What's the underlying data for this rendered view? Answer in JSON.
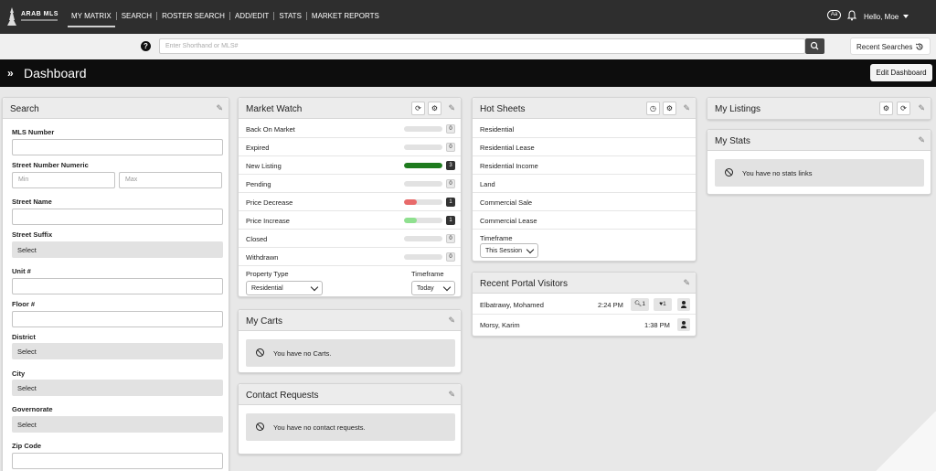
{
  "nav": {
    "brand": "ARAB MLS",
    "links": [
      "MY MATRIX",
      "SEARCH",
      "ROSTER SEARCH",
      "ADD/EDIT",
      "STATS",
      "MARKET REPORTS"
    ],
    "font_toggle": "Aa",
    "greeting": "Hello, Moe"
  },
  "searchbar": {
    "placeholder": "Enter Shorthand or MLS#",
    "recent_label": "Recent Searches"
  },
  "dashboard": {
    "title": "Dashboard",
    "edit_label": "Edit Dashboard"
  },
  "search_panel": {
    "title": "Search",
    "mls_label": "MLS Number",
    "street_num_label": "Street Number Numeric",
    "min_placeholder": "Min",
    "max_placeholder": "Max",
    "street_name_label": "Street Name",
    "street_suffix_label": "Street Suffix",
    "street_suffix_value": "Select",
    "unit_label": "Unit #",
    "floor_label": "Floor #",
    "district_label": "District",
    "district_value": "Select",
    "city_label": "City",
    "city_value": "Select",
    "governorate_label": "Governorate",
    "governorate_value": "Select",
    "zip_label": "Zip Code"
  },
  "market_watch": {
    "title": "Market Watch",
    "rows": [
      {
        "label": "Back On Market",
        "count": "0",
        "fraction": 0,
        "color": "#e2e2e2"
      },
      {
        "label": "Expired",
        "count": "0",
        "fraction": 0,
        "color": "#e2e2e2"
      },
      {
        "label": "New Listing",
        "count": "3",
        "fraction": 1,
        "color": "#1e7b1e"
      },
      {
        "label": "Pending",
        "count": "0",
        "fraction": 0,
        "color": "#e2e2e2"
      },
      {
        "label": "Price Decrease",
        "count": "1",
        "fraction": 0.33,
        "color": "#e86a6a"
      },
      {
        "label": "Price Increase",
        "count": "1",
        "fraction": 0.33,
        "color": "#8fe08f"
      },
      {
        "label": "Closed",
        "count": "0",
        "fraction": 0,
        "color": "#e2e2e2"
      },
      {
        "label": "Withdrawn",
        "count": "0",
        "fraction": 0,
        "color": "#e2e2e2"
      }
    ],
    "property_type_label": "Property Type",
    "property_type_value": "Residential",
    "timeframe_label": "Timeframe",
    "timeframe_value": "Today"
  },
  "carts": {
    "title": "My Carts",
    "empty": "You have no Carts."
  },
  "contact_requests": {
    "title": "Contact Requests",
    "empty": "You have no contact requests."
  },
  "hot_sheets": {
    "title": "Hot Sheets",
    "rows": [
      "Residential",
      "Residential Lease",
      "Residential Income",
      "Land",
      "Commercial Sale",
      "Commercial Lease"
    ],
    "timeframe_label": "Timeframe",
    "timeframe_value": "This Session"
  },
  "visitors": {
    "title": "Recent Portal Visitors",
    "rows": [
      {
        "name": "Elbatrawy, Mohamed",
        "time": "2:24 PM",
        "searches": "1",
        "favorites": "1"
      },
      {
        "name": "Morsy, Karim",
        "time": "1:38 PM"
      }
    ]
  },
  "my_listings": {
    "title": "My Listings"
  },
  "my_stats": {
    "title": "My Stats",
    "empty": "You have no stats links"
  }
}
